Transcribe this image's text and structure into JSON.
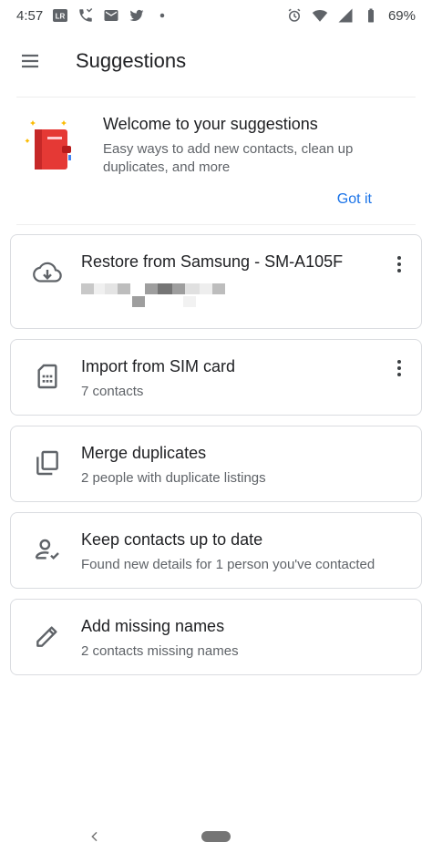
{
  "status_bar": {
    "time": "4:57",
    "battery": "69%",
    "left_icons": [
      "lr-app-icon",
      "missed-call-icon",
      "mail-icon",
      "twitter-icon",
      "dot-icon"
    ],
    "right_icons": [
      "alarm-icon",
      "wifi-icon",
      "signal-icon",
      "battery-icon"
    ]
  },
  "app_bar": {
    "title": "Suggestions"
  },
  "welcome": {
    "title": "Welcome to your suggestions",
    "description": "Easy ways to add new contacts, clean up duplicates, and more",
    "action": "Got it"
  },
  "cards": [
    {
      "title": "Restore from Samsung - SM-A105F",
      "subtitle": "",
      "icon": "cloud-download-icon",
      "has_menu": true
    },
    {
      "title": "Import from SIM card",
      "subtitle": "7 contacts",
      "icon": "sim-card-icon",
      "has_menu": true
    },
    {
      "title": "Merge duplicates",
      "subtitle": "2 people with duplicate listings",
      "icon": "copy-icon",
      "has_menu": false
    },
    {
      "title": "Keep contacts up to date",
      "subtitle": "Found new details for 1 person you've contacted",
      "icon": "person-check-icon",
      "has_menu": false
    },
    {
      "title": "Add missing names",
      "subtitle": "2 contacts missing names",
      "icon": "edit-icon",
      "has_menu": false
    }
  ],
  "colors": {
    "accent": "#1a73e8",
    "text_primary": "#202124",
    "text_secondary": "#5f6368",
    "border": "#dadce0",
    "illustration_red": "#e53935"
  }
}
